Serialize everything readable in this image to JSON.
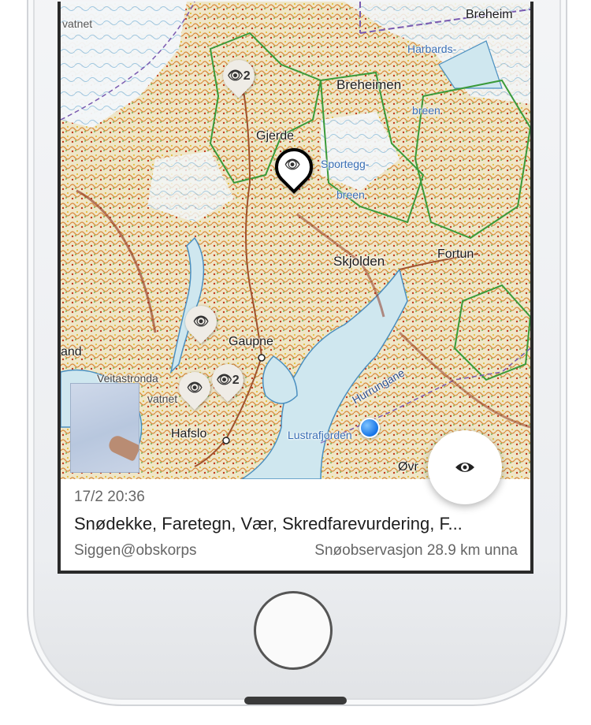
{
  "map": {
    "places": [
      {
        "name": "Breheimen"
      },
      {
        "name": "Harbards-"
      },
      {
        "name": "breen"
      },
      {
        "name": "Breheim"
      },
      {
        "name": "Gjerde"
      },
      {
        "name": "Sportegg-"
      },
      {
        "name": "breen"
      },
      {
        "name": "Skjolden"
      },
      {
        "name": "Fortun"
      },
      {
        "name": "Gaupne"
      },
      {
        "name": "Hafslo"
      },
      {
        "name": "Lustrafjorden"
      },
      {
        "name": "Hurrungane"
      },
      {
        "name": "Øvr"
      },
      {
        "name": "vatnet"
      },
      {
        "name": "and"
      },
      {
        "name": "Veitastronda"
      },
      {
        "name": "vatnet"
      }
    ],
    "pins": [
      {
        "label": "2",
        "icon": "eye-icon"
      },
      {
        "label": "",
        "icon": "eye-icon",
        "selected": true
      },
      {
        "label": "",
        "icon": "eye-icon"
      },
      {
        "label": "",
        "icon": "eye-icon"
      },
      {
        "label": "2",
        "icon": "eye-icon"
      }
    ],
    "colors": {
      "water": "#cfe7ef",
      "terrain": "#efe6c8",
      "relief": "#d86a2a",
      "border": "#3a9a3a",
      "boundary": "#7a5ab0"
    }
  },
  "fab": {
    "icon": "eye-icon"
  },
  "observation": {
    "date": "17/2 20:36",
    "title": "Snødekke, Faretegn, Vær, Skredfarevurdering, F...",
    "user": "Siggen@obskorps",
    "type_distance": "Snøobservasjon 28.9 km unna"
  }
}
